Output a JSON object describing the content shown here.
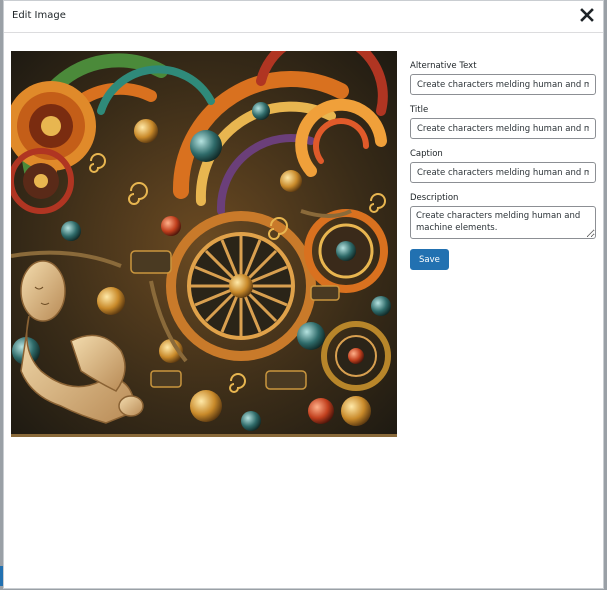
{
  "modal": {
    "title": "Edit Image",
    "close_icon": "close-icon"
  },
  "image": {
    "description": "surreal colorful illustration of humanoid figures merged with gears, spirals and mechanical parts",
    "palette": {
      "bg_dark": "#2a2418",
      "orange": "#d9711f",
      "gold": "#d8a64a",
      "cream": "#ead0a0",
      "teal": "#2f6b6a",
      "red": "#b03522",
      "purple": "#6b3f7a",
      "green": "#4b8a3a"
    }
  },
  "form": {
    "alt_text": {
      "label": "Alternative Text",
      "value": "Create characters melding human and machine elements."
    },
    "title": {
      "label": "Title",
      "value": "Create characters melding human and machine elements."
    },
    "caption": {
      "label": "Caption",
      "value": "Create characters melding human and machine elements."
    },
    "description": {
      "label": "Description",
      "value": "Create characters melding human and machine elements."
    },
    "save_label": "Save"
  },
  "colors": {
    "accent": "#2271b1"
  }
}
